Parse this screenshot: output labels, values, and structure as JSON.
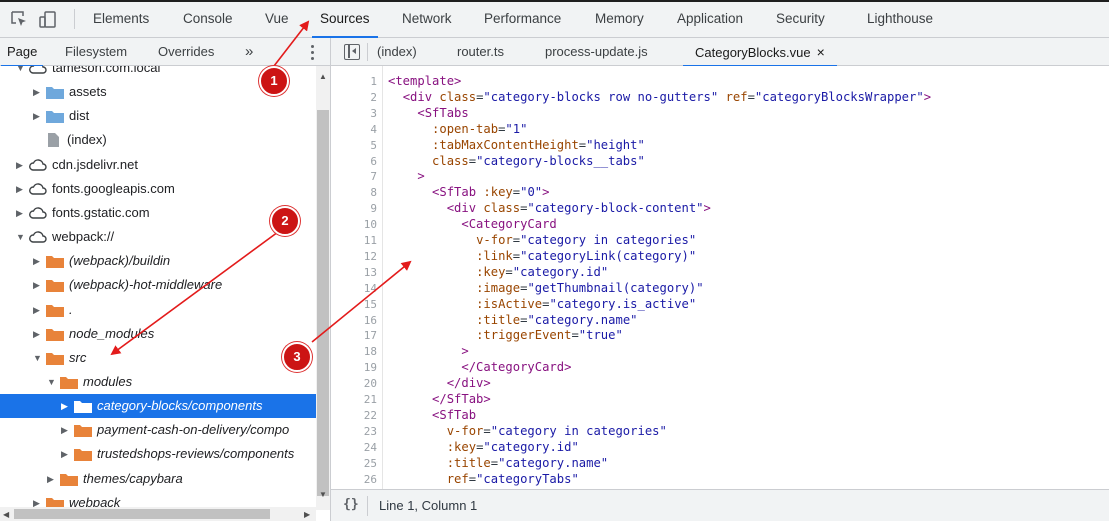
{
  "toolbar": {
    "tabs": [
      "Elements",
      "Console",
      "Vue",
      "Sources",
      "Network",
      "Performance",
      "Memory",
      "Application",
      "Security",
      "Lighthouse"
    ],
    "active_tab": "Sources"
  },
  "navigator": {
    "tabs": [
      "Page",
      "Filesystem",
      "Overrides"
    ],
    "more": "»",
    "tree": [
      {
        "label": "tameson.com.local",
        "icon": "cloud-icon",
        "expanded": true
      },
      {
        "label": "assets",
        "icon": "folder-icon"
      },
      {
        "label": "dist",
        "icon": "folder-icon"
      },
      {
        "label": "(index)",
        "icon": "file-icon"
      },
      {
        "label": "cdn.jsdelivr.net",
        "icon": "cloud-icon"
      },
      {
        "label": "fonts.googleapis.com",
        "icon": "cloud-icon"
      },
      {
        "label": "fonts.gstatic.com",
        "icon": "cloud-icon"
      },
      {
        "label": "webpack://",
        "icon": "cloud-icon",
        "expanded": true
      },
      {
        "label": "(webpack)/buildin",
        "icon": "folder-icon"
      },
      {
        "label": "(webpack)-hot-middleware",
        "icon": "folder-icon"
      },
      {
        "label": ".",
        "icon": "folder-icon"
      },
      {
        "label": "node_modules",
        "icon": "folder-icon"
      },
      {
        "label": "src",
        "icon": "folder-icon",
        "expanded": true
      },
      {
        "label": "modules",
        "icon": "folder-icon",
        "expanded": true
      },
      {
        "label": "category-blocks/components",
        "icon": "folder-icon",
        "selected": true
      },
      {
        "label": "payment-cash-on-delivery/compo",
        "icon": "folder-icon"
      },
      {
        "label": "trustedshops-reviews/components",
        "icon": "folder-icon"
      },
      {
        "label": "themes/capybara",
        "icon": "folder-icon"
      },
      {
        "label": "webpack",
        "icon": "folder-icon"
      }
    ]
  },
  "editor": {
    "tabs": [
      "(index)",
      "router.ts",
      "process-update.js",
      "CategoryBlocks.vue"
    ],
    "active_tab": "CategoryBlocks.vue",
    "close_glyph": "×",
    "lines": [
      [
        [
          "<template>",
          "t"
        ]
      ],
      [
        [
          "  ",
          "p"
        ],
        [
          "<div ",
          "t"
        ],
        [
          "class",
          "a"
        ],
        [
          "=",
          "p"
        ],
        [
          "\"category-blocks row no-gutters\"",
          "v"
        ],
        [
          " ",
          "p"
        ],
        [
          "ref",
          "a"
        ],
        [
          "=",
          "p"
        ],
        [
          "\"categoryBlocksWrapper\"",
          "v"
        ],
        [
          ">",
          "t"
        ]
      ],
      [
        [
          "    ",
          "p"
        ],
        [
          "<SfTabs",
          "t"
        ]
      ],
      [
        [
          "      ",
          "p"
        ],
        [
          ":open-tab",
          "a"
        ],
        [
          "=",
          "p"
        ],
        [
          "\"1\"",
          "v"
        ]
      ],
      [
        [
          "      ",
          "p"
        ],
        [
          ":tabMaxContentHeight",
          "a"
        ],
        [
          "=",
          "p"
        ],
        [
          "\"height\"",
          "v"
        ]
      ],
      [
        [
          "      ",
          "p"
        ],
        [
          "class",
          "a"
        ],
        [
          "=",
          "p"
        ],
        [
          "\"category-blocks__tabs\"",
          "v"
        ]
      ],
      [
        [
          "    ",
          "p"
        ],
        [
          ">",
          "t"
        ]
      ],
      [
        [
          "      ",
          "p"
        ],
        [
          "<SfTab ",
          "t"
        ],
        [
          ":key",
          "a"
        ],
        [
          "=",
          "p"
        ],
        [
          "\"0\"",
          "v"
        ],
        [
          ">",
          "t"
        ]
      ],
      [
        [
          "        ",
          "p"
        ],
        [
          "<div ",
          "t"
        ],
        [
          "class",
          "a"
        ],
        [
          "=",
          "p"
        ],
        [
          "\"category-block-content\"",
          "v"
        ],
        [
          ">",
          "t"
        ]
      ],
      [
        [
          "          ",
          "p"
        ],
        [
          "<CategoryCard",
          "t"
        ]
      ],
      [
        [
          "            ",
          "p"
        ],
        [
          "v-for",
          "a"
        ],
        [
          "=",
          "p"
        ],
        [
          "\"category in categories\"",
          "v"
        ]
      ],
      [
        [
          "            ",
          "p"
        ],
        [
          ":link",
          "a"
        ],
        [
          "=",
          "p"
        ],
        [
          "\"categoryLink(category)\"",
          "v"
        ]
      ],
      [
        [
          "            ",
          "p"
        ],
        [
          ":key",
          "a"
        ],
        [
          "=",
          "p"
        ],
        [
          "\"category.id\"",
          "v"
        ]
      ],
      [
        [
          "            ",
          "p"
        ],
        [
          ":image",
          "a"
        ],
        [
          "=",
          "p"
        ],
        [
          "\"getThumbnail(category)\"",
          "v"
        ]
      ],
      [
        [
          "            ",
          "p"
        ],
        [
          ":isActive",
          "a"
        ],
        [
          "=",
          "p"
        ],
        [
          "\"category.is_active\"",
          "v"
        ]
      ],
      [
        [
          "            ",
          "p"
        ],
        [
          ":title",
          "a"
        ],
        [
          "=",
          "p"
        ],
        [
          "\"category.name\"",
          "v"
        ]
      ],
      [
        [
          "            ",
          "p"
        ],
        [
          ":triggerEvent",
          "a"
        ],
        [
          "=",
          "p"
        ],
        [
          "\"true\"",
          "v"
        ]
      ],
      [
        [
          "          ",
          "p"
        ],
        [
          ">",
          "t"
        ]
      ],
      [
        [
          "          ",
          "p"
        ],
        [
          "</CategoryCard>",
          "t"
        ]
      ],
      [
        [
          "        ",
          "p"
        ],
        [
          "</div>",
          "t"
        ]
      ],
      [
        [
          "      ",
          "p"
        ],
        [
          "</SfTab>",
          "t"
        ]
      ],
      [
        [
          "      ",
          "p"
        ],
        [
          "<SfTab",
          "t"
        ]
      ],
      [
        [
          "        ",
          "p"
        ],
        [
          "v-for",
          "a"
        ],
        [
          "=",
          "p"
        ],
        [
          "\"category in categories\"",
          "v"
        ]
      ],
      [
        [
          "        ",
          "p"
        ],
        [
          ":key",
          "a"
        ],
        [
          "=",
          "p"
        ],
        [
          "\"category.id\"",
          "v"
        ]
      ],
      [
        [
          "        ",
          "p"
        ],
        [
          ":title",
          "a"
        ],
        [
          "=",
          "p"
        ],
        [
          "\"category.name\"",
          "v"
        ]
      ],
      [
        [
          "        ",
          "p"
        ],
        [
          "ref",
          "a"
        ],
        [
          "=",
          "p"
        ],
        [
          "\"categoryTabs\"",
          "v"
        ]
      ],
      [
        [
          "      ",
          "p"
        ],
        [
          ">",
          "t"
        ]
      ]
    ]
  },
  "status": {
    "format_glyph": "{}",
    "position": "Line 1, Column 1"
  },
  "annotations": {
    "badges": [
      "1",
      "2",
      "3"
    ],
    "color": "#e31b1b"
  },
  "colors": {
    "accent": "#1a73e8",
    "tag": "#881280",
    "attr": "#994500",
    "value": "#1a1aa6",
    "folder_blue": "#6fa8dc",
    "folder_orange": "#e8833a"
  }
}
